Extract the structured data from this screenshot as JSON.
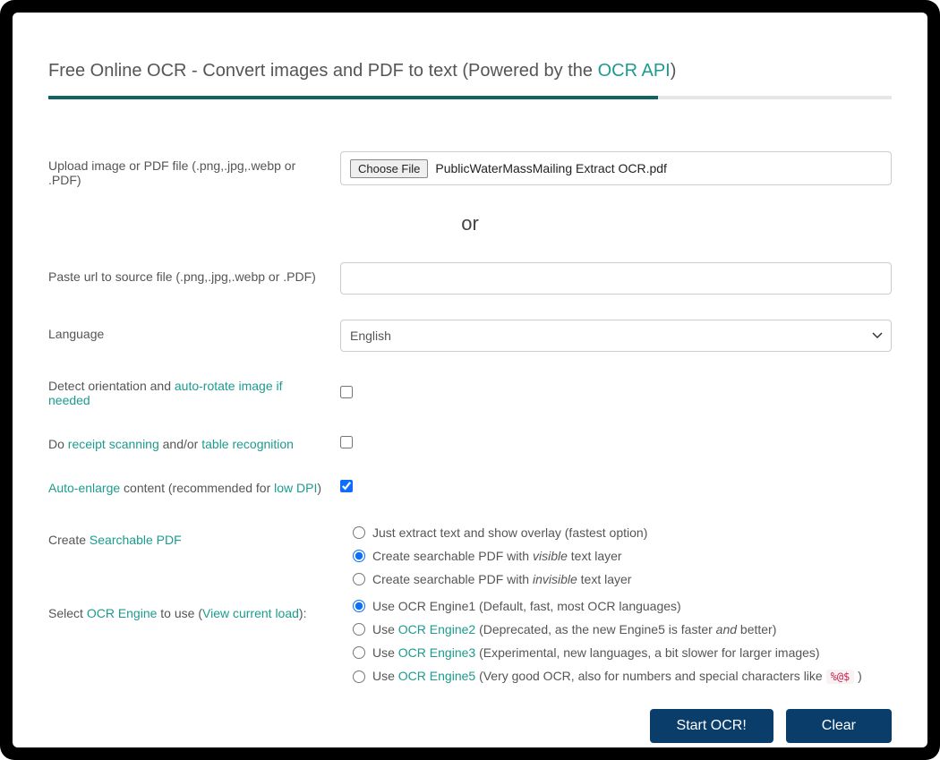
{
  "title_prefix": "Free Online OCR - Convert images and PDF to text (Powered by the ",
  "title_link": "OCR API",
  "title_suffix": ")",
  "labels": {
    "upload": "Upload image or PDF file (.png,.jpg,.webp or .PDF)",
    "choose_file": "Choose File",
    "filename": "PublicWaterMassMailing Extract OCR.pdf",
    "or": "or",
    "paste_url": "Paste url to source file (.png,.jpg,.webp or .PDF)",
    "language": "Language",
    "language_value": "English",
    "orientation_pre": "Detect orientation and ",
    "orientation_link": "auto-rotate image if needed",
    "receipt_pre": "Do ",
    "receipt_link1": "receipt scanning",
    "receipt_mid": " and/or ",
    "receipt_link2": "table recognition",
    "enlarge_link1": "Auto-enlarge",
    "enlarge_mid": " content (recommended for ",
    "enlarge_link2": "low DPI",
    "enlarge_suffix": ")",
    "searchable_pre": "Create ",
    "searchable_link": "Searchable PDF",
    "engine_pre": "Select ",
    "engine_link1": "OCR Engine",
    "engine_mid": " to use (",
    "engine_link2": "View current load",
    "engine_suffix": "):"
  },
  "pdf_options": [
    {
      "label_pre": "Just extract text and show overlay (fastest option)",
      "checked": false
    },
    {
      "label_pre": "Create searchable PDF with ",
      "em": "visible",
      "label_post": " text layer",
      "checked": true
    },
    {
      "label_pre": "Create searchable PDF with ",
      "em": "invisible",
      "label_post": " text layer",
      "checked": false
    }
  ],
  "engine_options": [
    {
      "pre": "Use OCR Engine1 (Default, fast, most OCR languages)",
      "checked": true
    },
    {
      "pre": "Use ",
      "link": "OCR Engine2",
      "post_pre": " (Deprecated, as the new Engine5 is faster ",
      "em": "and",
      "post_post": " better)",
      "checked": false
    },
    {
      "pre": "Use ",
      "link": "OCR Engine3",
      "post": " (Experimental, new languages, a bit slower for larger images)",
      "checked": false
    },
    {
      "pre": "Use ",
      "link": "OCR Engine5",
      "post": " (Very good OCR, also for numbers and special characters like ",
      "chip": "%@$",
      "post2": " )",
      "checked": false
    }
  ],
  "buttons": {
    "start": "Start OCR!",
    "clear": "Clear"
  },
  "checks": {
    "orientation": false,
    "receipt": false,
    "enlarge": true
  }
}
